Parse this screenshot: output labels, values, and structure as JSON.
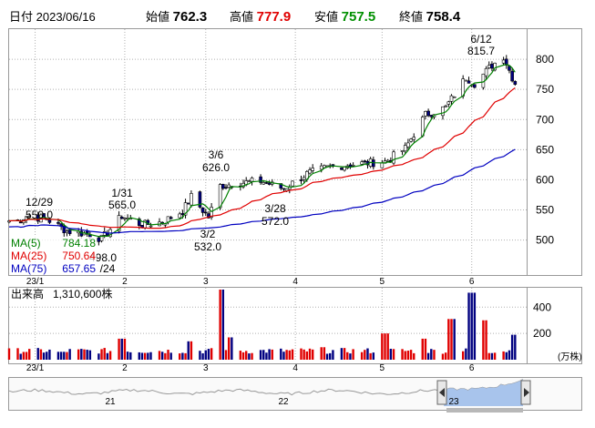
{
  "header": {
    "date_label": "日付",
    "date": "2023/06/16",
    "open_label": "始値",
    "open": "762.3",
    "high_label": "高値",
    "high": "777.9",
    "low_label": "安値",
    "low": "757.5",
    "close_label": "終値",
    "close": "758.4"
  },
  "colors": {
    "high": "#e00000",
    "low": "#009000",
    "up_candle": "#ffffff",
    "down_candle": "#000080",
    "ma5": "#008000",
    "ma25": "#e00000",
    "ma75": "#0000c0",
    "grid": "#b0b0b0",
    "volume_up": "#e00000",
    "volume_down": "#000080"
  },
  "chart_data": [
    {
      "type": "candlestick",
      "ylim": [
        445,
        850
      ],
      "y_ticks": [
        500,
        550,
        600,
        650,
        700,
        750,
        800
      ],
      "x_ticks": [
        {
          "label": "23/1",
          "date": "2023-01-01"
        },
        {
          "label": "2",
          "date": "2023-02-01"
        },
        {
          "label": "3",
          "date": "2023-03-01"
        },
        {
          "label": "4",
          "date": "2023-04-01"
        },
        {
          "label": "5",
          "date": "2023-05-01"
        },
        {
          "label": "6",
          "date": "2023-06-01"
        }
      ],
      "annotations": [
        {
          "date": "12/29",
          "value": "550.0"
        },
        {
          "date": "1/31",
          "value": "565.0"
        },
        {
          "date": "3/6",
          "value": "626.0"
        },
        {
          "date": "3/2",
          "value": "532.0"
        },
        {
          "date": "3/28",
          "value": "572.0"
        },
        {
          "date": "6/12",
          "value": "815.7"
        }
      ],
      "partial_annotations": [
        {
          "text": "498.0"
        },
        {
          "text": "/24"
        }
      ],
      "legend": [
        {
          "name": "MA(5)",
          "value": "784.18",
          "color": "#008000"
        },
        {
          "name": "MA(25)",
          "value": "750.64",
          "color": "#e00000"
        },
        {
          "name": "MA(75)",
          "value": "657.65",
          "color": "#0000c0"
        }
      ],
      "legend_placement": "bottom-left",
      "close_series": [
        {
          "date": "2022-12-26",
          "close": 532
        },
        {
          "date": "2022-12-29",
          "close": 540
        },
        {
          "date": "2023-01-05",
          "close": 535
        },
        {
          "date": "2023-01-12",
          "close": 515
        },
        {
          "date": "2023-01-19",
          "close": 510
        },
        {
          "date": "2023-01-24",
          "close": 502
        },
        {
          "date": "2023-01-31",
          "close": 540
        },
        {
          "date": "2023-02-07",
          "close": 525
        },
        {
          "date": "2023-02-14",
          "close": 530
        },
        {
          "date": "2023-02-21",
          "close": 548
        },
        {
          "date": "2023-02-24",
          "close": 572
        },
        {
          "date": "2023-03-02",
          "close": 538
        },
        {
          "date": "2023-03-06",
          "close": 590
        },
        {
          "date": "2023-03-13",
          "close": 595
        },
        {
          "date": "2023-03-20",
          "close": 598
        },
        {
          "date": "2023-03-28",
          "close": 585
        },
        {
          "date": "2023-04-05",
          "close": 610
        },
        {
          "date": "2023-04-12",
          "close": 620
        },
        {
          "date": "2023-04-19",
          "close": 625
        },
        {
          "date": "2023-04-26",
          "close": 628
        },
        {
          "date": "2023-05-02",
          "close": 630
        },
        {
          "date": "2023-05-09",
          "close": 652
        },
        {
          "date": "2023-05-16",
          "close": 708
        },
        {
          "date": "2023-05-23",
          "close": 720
        },
        {
          "date": "2023-05-30",
          "close": 770
        },
        {
          "date": "2023-06-02",
          "close": 760
        },
        {
          "date": "2023-06-08",
          "close": 790
        },
        {
          "date": "2023-06-12",
          "close": 805
        },
        {
          "date": "2023-06-16",
          "close": 758.4
        }
      ]
    },
    {
      "type": "bar",
      "title": "出来高",
      "value": "1,310,600株",
      "unit": "(万株)",
      "ylim": [
        0,
        520
      ],
      "y_ticks": [
        200,
        400
      ],
      "volume_series": [
        {
          "date": "2023-01-10",
          "volume": 60
        },
        {
          "date": "2023-01-31",
          "volume": 160
        },
        {
          "date": "2023-02-24",
          "volume": 140
        },
        {
          "date": "2023-03-06",
          "volume": 600
        },
        {
          "date": "2023-03-10",
          "volume": 170
        },
        {
          "date": "2023-04-10",
          "volume": 95
        },
        {
          "date": "2023-05-02",
          "volume": 200
        },
        {
          "date": "2023-05-15",
          "volume": 160
        },
        {
          "date": "2023-05-25",
          "volume": 310
        },
        {
          "date": "2023-06-01",
          "volume": 510
        },
        {
          "date": "2023-06-05",
          "volume": 300
        },
        {
          "date": "2023-06-16",
          "volume": 190
        }
      ]
    },
    {
      "type": "area",
      "name": "overview-navigator",
      "x_ticks": [
        "21",
        "22",
        "23"
      ]
    }
  ]
}
